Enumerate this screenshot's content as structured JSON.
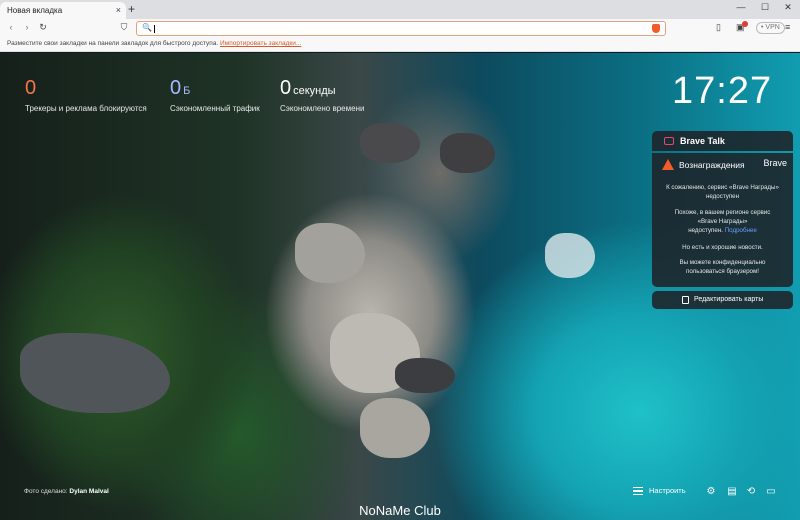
{
  "tab": {
    "title": "Новая вкладка",
    "close": "×",
    "new_tab": "+"
  },
  "window": {
    "minimize": "—",
    "maximize": "☐",
    "close": "✕"
  },
  "nav": {
    "back": "‹",
    "forward": "›",
    "reload": "↻",
    "bookmark": "⛉"
  },
  "urlbar": {
    "value": "",
    "search_icon": "🔍"
  },
  "toolbar": {
    "sidebar": "▯",
    "wallet": "▣",
    "vpn": "• VPN",
    "menu": "≡"
  },
  "bookmarks_bar": {
    "text": "Разместите свои закладки на панели закладок для быстрого доступа.",
    "link": "Импортировать закладки..."
  },
  "stats": [
    {
      "value": "0",
      "unit": "",
      "label": "Трекеры и реклама блокируются",
      "color": "#f7744a"
    },
    {
      "value": "0",
      "unit": "Б",
      "label": "Сэкономленный трафик",
      "color": "#a9b7ff"
    },
    {
      "value": "0",
      "unit": "секунды",
      "label": "Сэкономлено времени",
      "color": "#ffffff"
    }
  ],
  "clock": "17:27",
  "brave_talk": {
    "label": "Brave Talk"
  },
  "rewards": {
    "title": "Вознаграждения",
    "brand": "Brave",
    "line1": "К сожалению, сервис «Brave Награды»",
    "line2": "недоступен",
    "line3": "Похоже, в вашем регионе сервис",
    "line4": "«Brave Награды»",
    "line5": "недоступен.",
    "link": "Подробнее",
    "line6": "Но есть и хорошие новости.",
    "line7": "Вы можете конфиденциально",
    "line8": "пользоваться браузером!"
  },
  "edit_cards": {
    "label": "Редактировать карты"
  },
  "photo_credit": {
    "prefix": "Фото сделано:",
    "author": "Dylan Malval"
  },
  "footer": {
    "settings": "Настроить"
  },
  "bottom_icons": {
    "gear": "⚙",
    "bookmarks": "▤",
    "history": "⟲",
    "video": "▭"
  },
  "watermark": "NoNaMe Club"
}
